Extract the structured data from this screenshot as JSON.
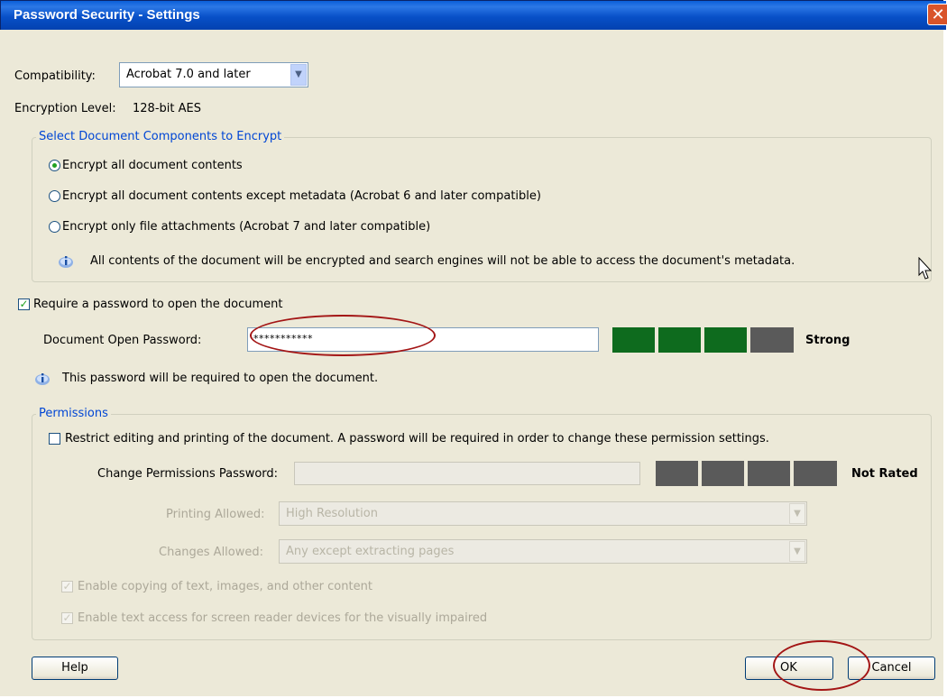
{
  "window": {
    "title": "Password Security - Settings",
    "close_symbol": "✕"
  },
  "compatibility": {
    "label": "Compatibility:",
    "value": "Acrobat 7.0 and later"
  },
  "encryption": {
    "label": "Encryption Level:",
    "value": "128-bit AES"
  },
  "components": {
    "title": "Select Document Components to Encrypt",
    "options": [
      {
        "label": "Encrypt all document contents",
        "selected": true
      },
      {
        "label": "Encrypt all document contents except metadata (Acrobat 6 and later compatible)",
        "selected": false
      },
      {
        "label": "Encrypt only file attachments (Acrobat 7 and later compatible)",
        "selected": false
      }
    ],
    "info": "All contents of the document will be encrypted and search engines will not be able to access the document's metadata."
  },
  "open_password": {
    "checkbox_label": "Require a password to open the document",
    "checked": true,
    "field_label": "Document Open Password:",
    "value": "***********",
    "strength": "Strong",
    "strength_level": 0.75,
    "info": "This password will be required to open the document."
  },
  "permissions": {
    "title": "Permissions",
    "restrict_label": "Restrict editing and printing of the document. A password will be required in order to change these permission settings.",
    "restrict_checked": false,
    "password_label": "Change Permissions Password:",
    "password_value": "",
    "strength": "Not Rated",
    "strength_level": 0,
    "printing_label": "Printing Allowed:",
    "printing_value": "High Resolution",
    "changes_label": "Changes Allowed:",
    "changes_value": "Any except extracting pages",
    "copy_label": "Enable copying of text, images, and other content",
    "copy_checked": true,
    "access_label": "Enable text access for screen reader devices for the visually impaired",
    "access_checked": true
  },
  "buttons": {
    "help": "Help",
    "ok": "OK",
    "cancel": "Cancel"
  },
  "colors": {
    "strong_meter": "#0e6b1e",
    "empty_meter": "#5a5a5a",
    "annotation_ellipse": "#a31515"
  }
}
